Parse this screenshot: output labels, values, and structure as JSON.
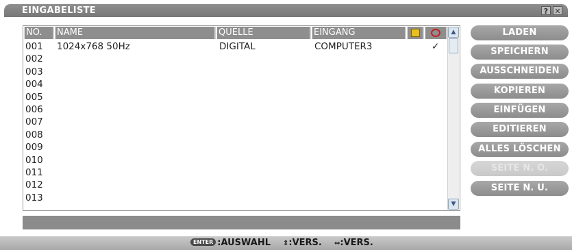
{
  "window": {
    "title": "EINGABELISTE",
    "help_label": "?",
    "close_label": "✕"
  },
  "list": {
    "columns": {
      "no": "NO.",
      "name": "NAME",
      "source": "QUELLE",
      "input": "EINGANG"
    },
    "lock_icon": "lock-icon",
    "mark_icon": "magnifier-icon",
    "rows": [
      {
        "no": "001",
        "name": "1024x768 50Hz",
        "source": "DIGITAL",
        "input": "COMPUTER3",
        "mark": "✓"
      },
      {
        "no": "002",
        "name": "",
        "source": "",
        "input": "",
        "mark": ""
      },
      {
        "no": "003",
        "name": "",
        "source": "",
        "input": "",
        "mark": ""
      },
      {
        "no": "004",
        "name": "",
        "source": "",
        "input": "",
        "mark": ""
      },
      {
        "no": "005",
        "name": "",
        "source": "",
        "input": "",
        "mark": ""
      },
      {
        "no": "006",
        "name": "",
        "source": "",
        "input": "",
        "mark": ""
      },
      {
        "no": "007",
        "name": "",
        "source": "",
        "input": "",
        "mark": ""
      },
      {
        "no": "008",
        "name": "",
        "source": "",
        "input": "",
        "mark": ""
      },
      {
        "no": "009",
        "name": "",
        "source": "",
        "input": "",
        "mark": ""
      },
      {
        "no": "010",
        "name": "",
        "source": "",
        "input": "",
        "mark": ""
      },
      {
        "no": "011",
        "name": "",
        "source": "",
        "input": "",
        "mark": ""
      },
      {
        "no": "012",
        "name": "",
        "source": "",
        "input": "",
        "mark": ""
      },
      {
        "no": "013",
        "name": "",
        "source": "",
        "input": "",
        "mark": ""
      }
    ],
    "scroll_up": "▲",
    "scroll_down": "▼"
  },
  "buttons": [
    {
      "label": "LADEN",
      "enabled": true
    },
    {
      "label": "SPEICHERN",
      "enabled": true
    },
    {
      "label": "AUSSCHNEIDEN",
      "enabled": true
    },
    {
      "label": "KOPIEREN",
      "enabled": true
    },
    {
      "label": "EINFÜGEN",
      "enabled": true
    },
    {
      "label": "EDITIEREN",
      "enabled": true
    },
    {
      "label": "ALLES LÖSCHEN",
      "enabled": true
    },
    {
      "label": "SEITE N. O.",
      "enabled": false
    },
    {
      "label": "SEITE N. U.",
      "enabled": true
    }
  ],
  "footer": {
    "enter_key": "ENTER",
    "select": ":AUSWAHL",
    "updown_symbol": "⇕",
    "updown": ":VERS.",
    "leftright_symbol": "⇔",
    "leftright": ":VERS."
  }
}
